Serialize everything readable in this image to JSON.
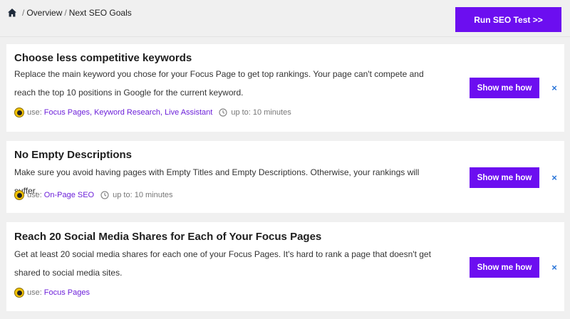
{
  "breadcrumb": {
    "items": [
      "Overview",
      "Next SEO Goals"
    ]
  },
  "header": {
    "run_button_label": "Run SEO Test >>"
  },
  "goals": [
    {
      "title": "Choose less competitive keywords",
      "description": "Replace the main keyword you chose for your Focus Page to get top rankings. Your page can't compete and reach the top 10 positions in Google for the current keyword.",
      "use_label": "use:",
      "tools": [
        "Focus Pages",
        "Keyword Research",
        "Live Assistant"
      ],
      "time": "up to: 10 minutes",
      "button_label": "Show me how"
    },
    {
      "title": "No Empty Descriptions",
      "description": "Make sure you avoid having pages with Empty Titles and Empty Descriptions. Otherwise, your rankings will suffer.",
      "use_label": "use:",
      "tools": [
        "On-Page SEO"
      ],
      "time": "up to: 10 minutes",
      "button_label": "Show me how"
    },
    {
      "title": "Reach 20 Social Media Shares for Each of Your Focus Pages",
      "description": "Get at least 20 social media shares for each one of your Focus Pages. It's hard to rank a page that doesn't get shared to social media sites.",
      "use_label": "use:",
      "tools": [
        "Focus Pages"
      ],
      "time": "",
      "button_label": "Show me how"
    }
  ],
  "colors": {
    "accent": "#6c0ef0",
    "link": "#6c1fd9",
    "close": "#2874d8",
    "background": "#f0f0f0"
  },
  "icons": {
    "home": "home-icon",
    "tool": "tool-badge-icon",
    "clock": "clock-icon",
    "close": "close-icon"
  }
}
